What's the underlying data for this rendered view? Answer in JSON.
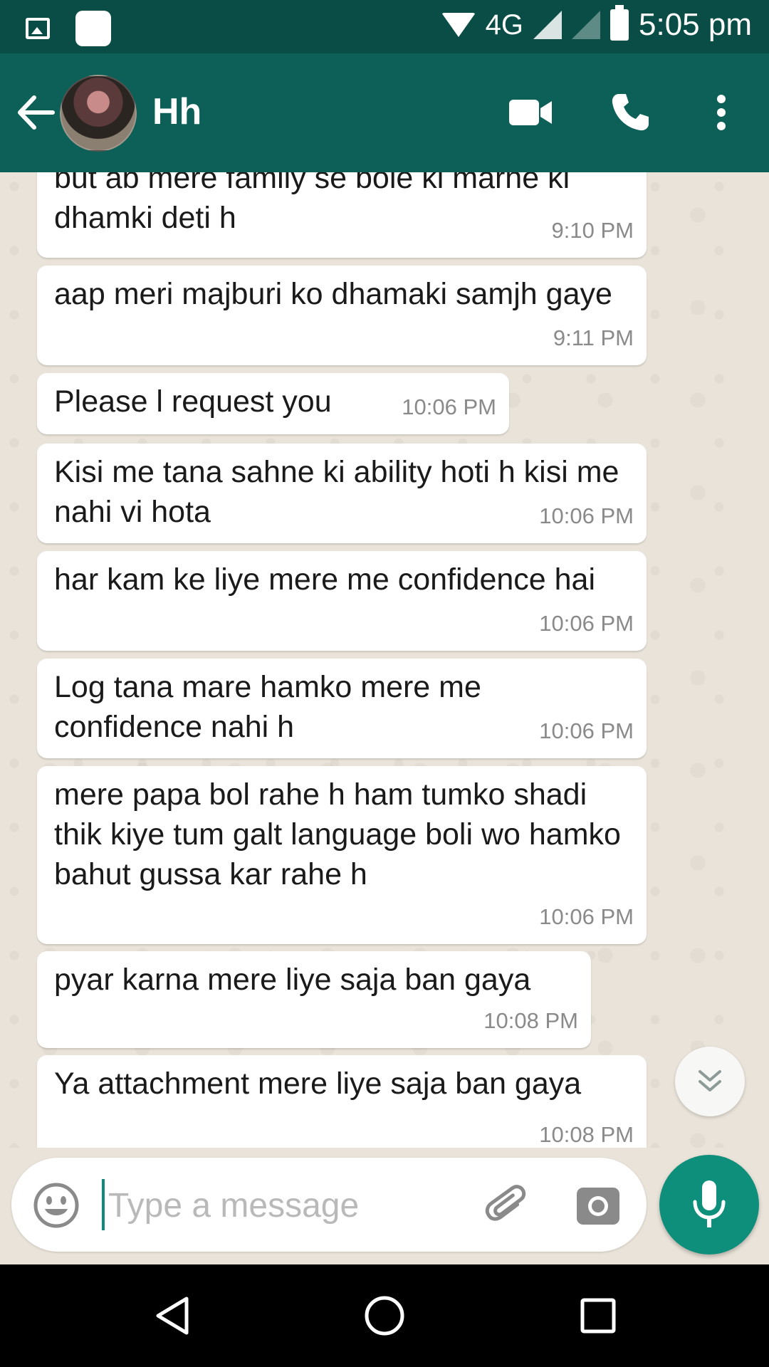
{
  "status_bar": {
    "network": "4G",
    "time": "5:05 pm",
    "icons": [
      "gallery-icon",
      "app-icon",
      "wifi-icon",
      "signal-icon",
      "battery-icon"
    ]
  },
  "header": {
    "contact_name": "Hh",
    "icons": [
      "back-arrow-icon",
      "contact-avatar",
      "video-call-icon",
      "voice-call-icon",
      "more-options-icon"
    ]
  },
  "messages": [
    {
      "text": "but ab mere family se bole ki marne ki dhamki deti h",
      "time": "9:10 PM"
    },
    {
      "text": "aap meri majburi ko dhamaki samjh gaye",
      "time": "9:11 PM"
    },
    {
      "text": "Please l request you",
      "time": "10:06 PM"
    },
    {
      "text": "Kisi me tana sahne ki ability hoti h kisi me nahi vi hota",
      "time": "10:06 PM"
    },
    {
      "text": "har kam ke liye mere me confidence hai",
      "time": "10:06 PM"
    },
    {
      "text": "Log tana mare hamko mere me confidence nahi h",
      "time": "10:06 PM"
    },
    {
      "text": "mere papa bol rahe h ham tumko shadi thik kiye tum galt language boli wo hamko bahut gussa kar rahe h",
      "time": "10:06 PM"
    },
    {
      "text": "pyar karna mere liye saja ban gaya",
      "time": "10:08 PM"
    },
    {
      "text": "Ya attachment mere liye saja ban gaya",
      "time": "10:08 PM"
    }
  ],
  "composer": {
    "placeholder": "Type a message",
    "value": "",
    "icons": [
      "emoji-icon",
      "attach-icon",
      "camera-icon",
      "mic-icon"
    ]
  },
  "nav_bar": {
    "icons": [
      "nav-back-icon",
      "nav-home-icon",
      "nav-recents-icon"
    ]
  },
  "colors": {
    "status_bar": "#0a4d46",
    "app_bar": "#0d6058",
    "accent": "#0e8f7c",
    "chat_background": "#e9e3d9",
    "bubble": "#ffffff"
  }
}
